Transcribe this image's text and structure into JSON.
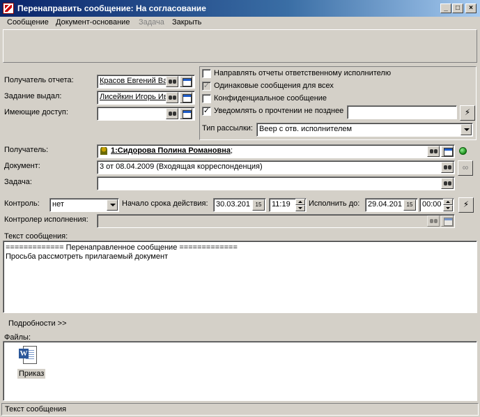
{
  "window": {
    "title": "Перенаправить сообщение: На согласование",
    "min": "_",
    "max": "□",
    "close": "×"
  },
  "menu": {
    "items": [
      "Сообщение",
      "Документ-основание",
      "Задача",
      "Закрыть"
    ]
  },
  "form": {
    "report_recipient": {
      "label": "Получатель отчета:",
      "value": "Красов Евгений Ва"
    },
    "task_issued": {
      "label": "Задание выдал:",
      "value": "Лисейкин Игорь Ив"
    },
    "access": {
      "label": "Имеющие доступ:",
      "value": ""
    },
    "options": {
      "send_reports": {
        "label": "Направлять отчеты ответственному исполнителю",
        "checked": false
      },
      "same_messages": {
        "label": "Одинаковые сообщения для всех",
        "checked": true
      },
      "confidential": {
        "label": "Конфиденциальное сообщение",
        "checked": false
      },
      "notify_read": {
        "label": "Уведомлять о прочтении не позднее",
        "checked": true,
        "value": ""
      },
      "mailing_type": {
        "label": "Тип рассылки:",
        "value": "Веер с отв. исполнителем"
      }
    },
    "recipient": {
      "label": "Получатель:",
      "value": "1:Сидорова Полина Романовна",
      "suffix": ";"
    },
    "document": {
      "label": "Документ:",
      "value": "3 от 08.04.2009 (Входящая корреспонденция)"
    },
    "task": {
      "label": "Задача:",
      "value": ""
    },
    "control": {
      "label": "Контроль:",
      "value": "нет"
    },
    "start": {
      "label": "Начало срока действия:",
      "date": "30.03.201",
      "time": "11:19"
    },
    "deadline": {
      "label": "Исполнить до:",
      "date": "29.04.201",
      "time": "00:00"
    },
    "controller": {
      "label": "Контролер исполнения:",
      "value": ""
    },
    "message": {
      "label": "Текст сообщения:",
      "lines": [
        "============= Перенаправленное сообщение =============",
        "Просьба рассмотреть прилагаемый документ"
      ]
    },
    "details": "Подробности >>",
    "files": {
      "label": "Файлы:",
      "items": [
        {
          "name": "Приказ",
          "icon": "word-document-icon"
        }
      ]
    }
  },
  "status": {
    "text": "Текст сообщения"
  },
  "calendar_glyph": "15"
}
